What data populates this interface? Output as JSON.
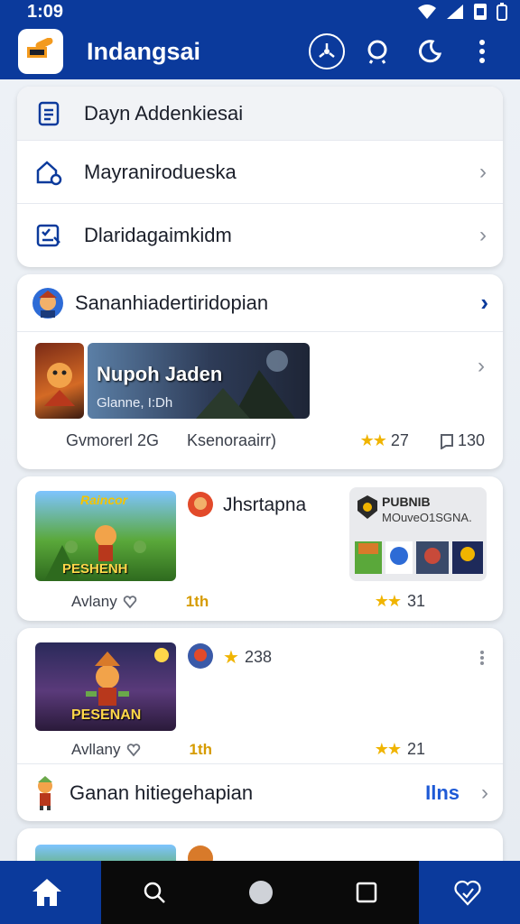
{
  "status_bar": {
    "time": "1:09"
  },
  "app_bar": {
    "title": "Indangsai"
  },
  "menu": [
    {
      "label": "Dayn Addenkiesai",
      "icon": "document-icon"
    },
    {
      "label": "Mayranirodueska",
      "icon": "home-lock-icon"
    },
    {
      "label": "Dlaridagaimkidm",
      "icon": "puzzle-checklist-icon"
    }
  ],
  "featured_section": {
    "title": "Sananhiadertiridopian",
    "banner_title": "Nupoh Jaden",
    "banner_subtitle": "Glanne, I:Dh",
    "left_stat": "Gvmorerl 2G",
    "mid_stat": "Ksenoraairr)",
    "rating": "27",
    "count": "130"
  },
  "game_cards": [
    {
      "thumb_top": "Raincor",
      "thumb_bottom": "PESHENH",
      "title": "Jhsrtapna",
      "promo_title": "PUBNIB",
      "promo_subtitle": "MOuveO1SGNA.",
      "meta_left": "Avlany",
      "meta_mid": "1th",
      "rating": "31"
    },
    {
      "thumb_bottom": "PESENAN",
      "rating_inline": "238",
      "meta_left": "Avllany",
      "meta_mid": "1th",
      "rating": "21"
    }
  ],
  "footer_row": {
    "label": "Ganan hitiegehapian",
    "badge": "Ilns"
  },
  "colors": {
    "brand": "#0b3a9c",
    "star": "#f0b400",
    "accent_gold": "#d69b00"
  }
}
